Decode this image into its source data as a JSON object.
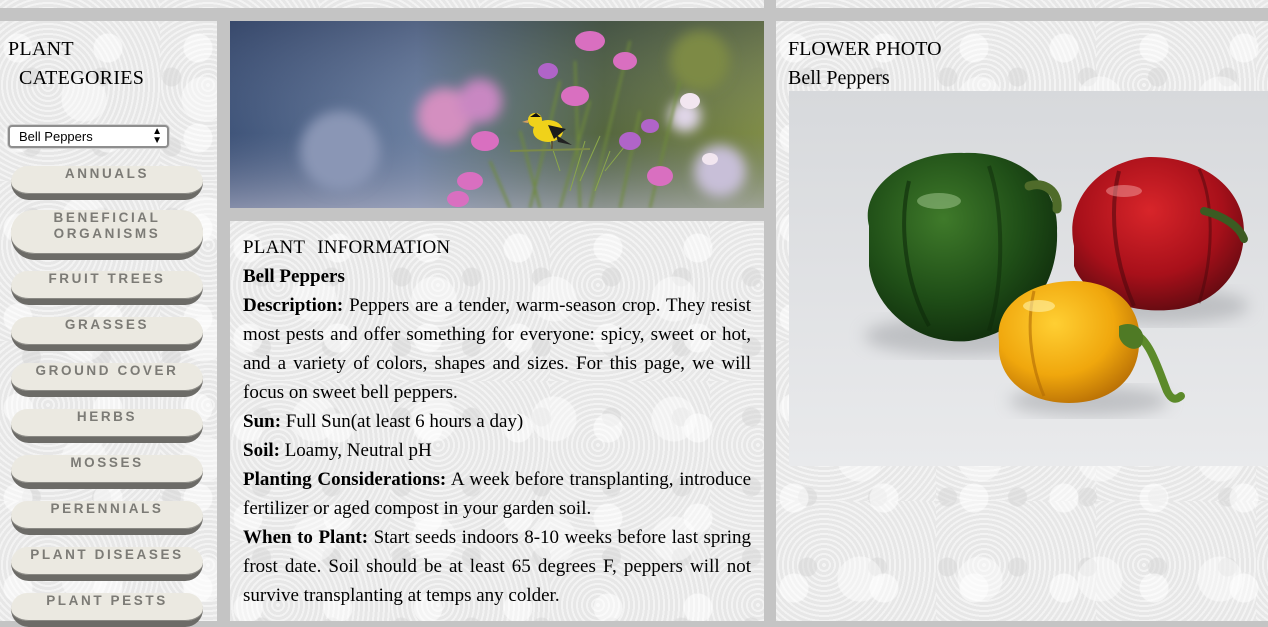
{
  "sidebar": {
    "title_line1": "PLANT",
    "title_line2": "CATEGORIES",
    "select_value": "Bell Peppers",
    "categories": [
      {
        "line1": "ANNUALS",
        "line2": ""
      },
      {
        "line1": "BENEFICIAL",
        "line2": "ORGANISMS"
      },
      {
        "line1": "FRUIT TREES",
        "line2": ""
      },
      {
        "line1": "GRASSES",
        "line2": ""
      },
      {
        "line1": "GROUND COVER",
        "line2": ""
      },
      {
        "line1": "HERBS",
        "line2": ""
      },
      {
        "line1": "MOSSES",
        "line2": ""
      },
      {
        "line1": "PERENNIALS",
        "line2": ""
      },
      {
        "line1": "PLANT DISEASES",
        "line2": ""
      },
      {
        "line1": "PLANT PESTS",
        "line2": ""
      }
    ]
  },
  "info": {
    "heading_word1": "PLANT",
    "heading_word2": "INFORMATION",
    "plant_name": "Bell Peppers",
    "description_label": "Description:",
    "description_text": "Peppers are a tender, warm-season crop. They resist most pests and offer something for everyone: spicy, sweet or hot, and a variety of colors, shapes and sizes. For this page, we will focus on sweet bell peppers.",
    "sun_label": "Sun:",
    "sun_text": "Full Sun(at least 6 hours a day)",
    "soil_label": "Soil:",
    "soil_text": "Loamy, Neutral pH",
    "planting_label": "Planting Considerations:",
    "planting_text": "A week before transplanting, introduce fertilizer or aged compost in your garden soil.",
    "when_label": "When to Plant:",
    "when_text": "Start seeds indoors 8-10 weeks before last spring frost date. Soil should be at least 65 degrees F, peppers will not survive transplanting at temps any colder."
  },
  "photo": {
    "title": "FLOWER PHOTO",
    "subtitle": "Bell Peppers"
  },
  "icons": {
    "select_arrows": "up-down-arrows-icon"
  }
}
